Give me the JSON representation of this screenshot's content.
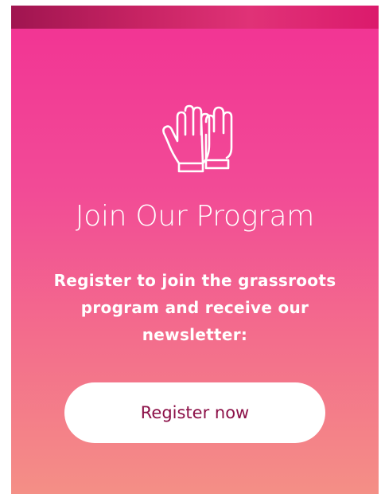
{
  "header": {
    "icon": "gloves-icon"
  },
  "main": {
    "title": "Join Our Program",
    "description": "Register to join the grassroots program and receive our newsletter:",
    "cta_label": "Register now"
  },
  "colors": {
    "gradient_top": "#f23294",
    "gradient_bottom": "#f48f86",
    "strip": "#c72363",
    "button_bg": "#ffffff",
    "button_text": "#8c1148"
  }
}
